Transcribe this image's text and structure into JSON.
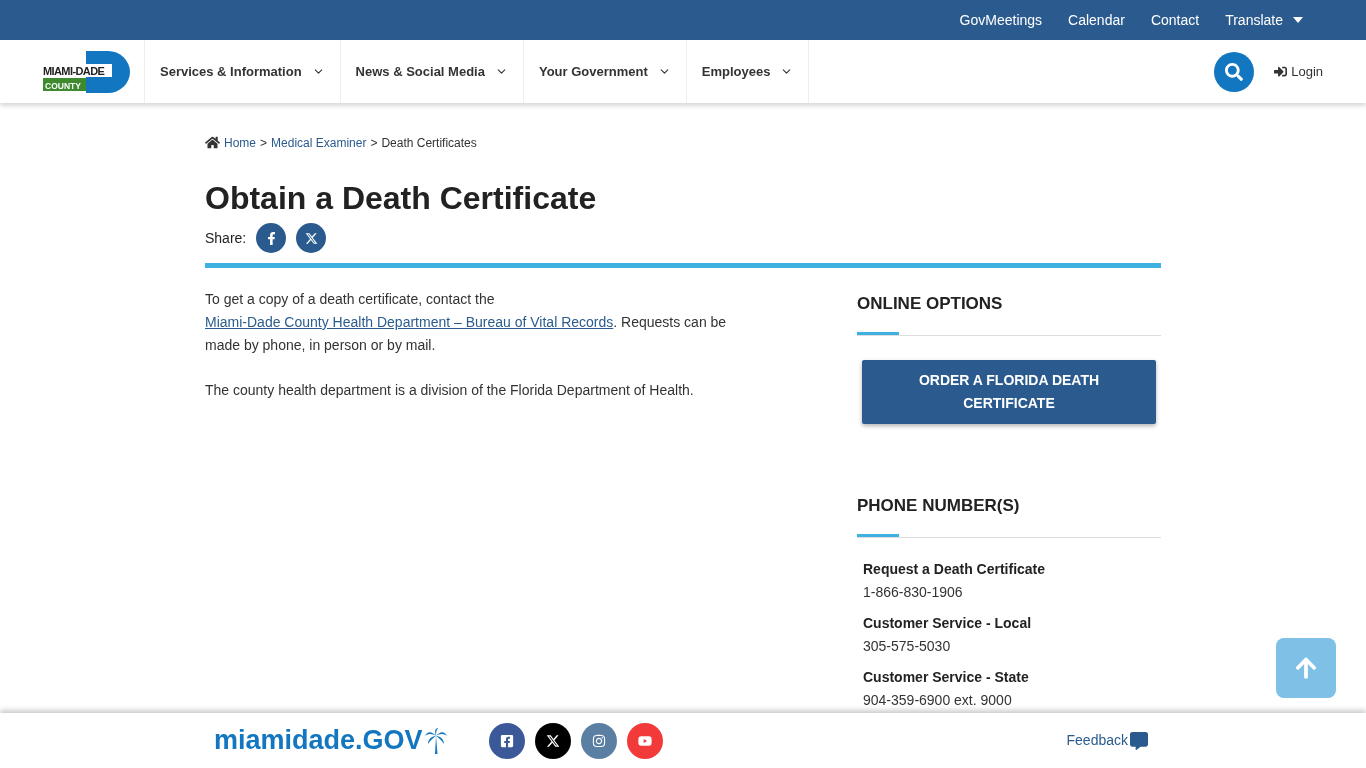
{
  "top_bar": {
    "links": [
      {
        "label": "GovMeetings",
        "kind": "link"
      },
      {
        "label": "Calendar",
        "kind": "link"
      },
      {
        "label": "Contact",
        "kind": "link"
      },
      {
        "label": "Translate",
        "kind": "dropdown"
      }
    ]
  },
  "logo": {
    "line_1": "MIAMI-DADE",
    "line_2": "COUNTY"
  },
  "nav": {
    "items": [
      {
        "label": "Services & Information"
      },
      {
        "label": "News & Social Media"
      },
      {
        "label": "Your Government"
      },
      {
        "label": "Employees"
      }
    ],
    "login": "Login"
  },
  "breadcrumb_separator": ">",
  "breadcrumb": [
    {
      "label": "Home",
      "kind": "link"
    },
    {
      "label": "Medical Examiner",
      "kind": "link"
    },
    {
      "label": "Death Certificates",
      "kind": "current"
    }
  ],
  "title": "Obtain a Death Certificate",
  "share": {
    "label": "Share:",
    "buttons": [
      {
        "kind": "facebook"
      },
      {
        "kind": "x"
      }
    ]
  },
  "paragraphs": [
    {
      "parts": [
        {
          "kind": "text",
          "text": "To get a copy of a death certificate, contact the "
        },
        {
          "kind": "link",
          "text": "Miami-Dade County Health Department – Bureau of Vital Records"
        },
        {
          "kind": "text",
          "text": ". Requests can be made by phone, in person or by mail."
        }
      ]
    },
    {
      "parts": [
        {
          "kind": "text",
          "text": "The county health department is a division of the Florida Department of Health."
        }
      ]
    }
  ],
  "sidebar": {
    "online_options": {
      "heading": "ONLINE OPTIONS",
      "button": "ORDER A FLORIDA DEATH CERTIFICATE"
    },
    "phone_numbers": {
      "heading": "PHONE NUMBER(S)",
      "entries": [
        {
          "label": "Request a Death Certificate",
          "number": "1-866-830-1906"
        },
        {
          "label": "Customer Service - Local",
          "number": "305-575-5030"
        },
        {
          "label": "Customer Service - State",
          "number": "904-359-6900 ext. 9000"
        }
      ]
    }
  },
  "footer": {
    "logo_text": "miamidade.GOV",
    "social": [
      {
        "kind": "facebook",
        "color": "#3b5998"
      },
      {
        "kind": "x",
        "color": "#000000"
      },
      {
        "kind": "instagram",
        "color": "#5b7fa3"
      },
      {
        "kind": "youtube",
        "color": "#f33a3a"
      }
    ],
    "feedback": "Feedback"
  }
}
